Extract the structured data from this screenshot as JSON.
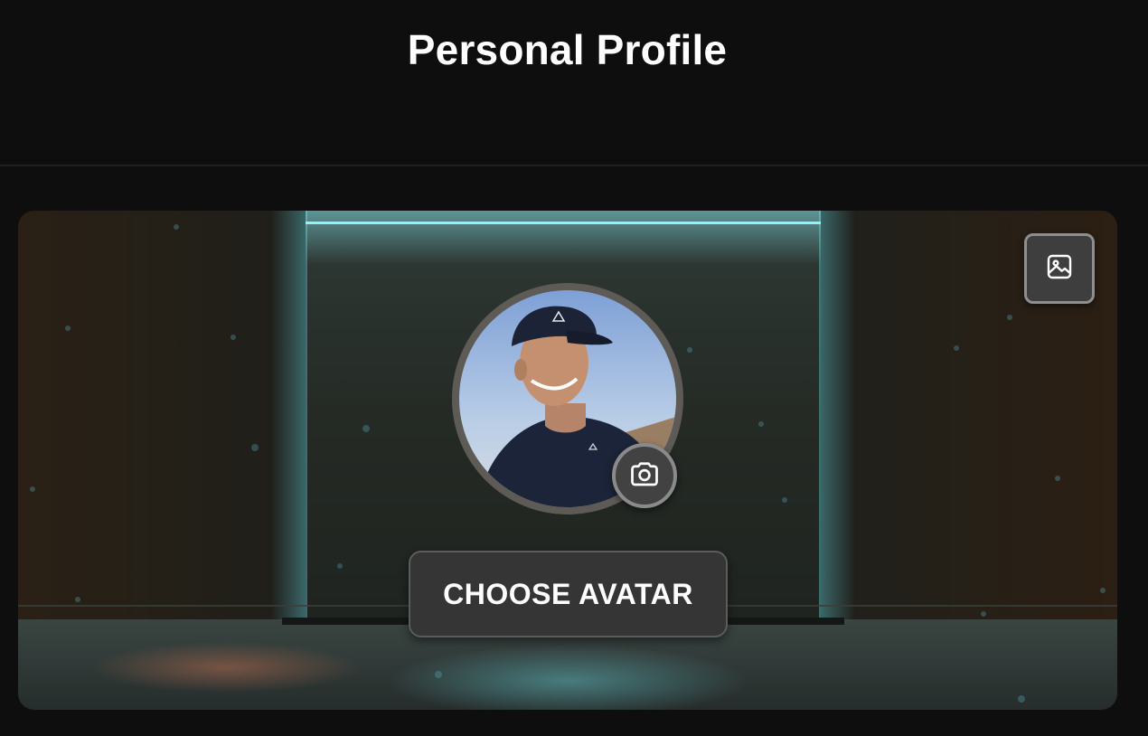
{
  "header": {
    "title": "Personal Profile"
  },
  "banner": {
    "change_background_icon": "image-icon"
  },
  "avatar": {
    "change_photo_icon": "camera-icon",
    "choose_label": "CHOOSE AVATAR"
  },
  "colors": {
    "page_background": "#0e0e0e",
    "neon_accent": "#7fe6ee",
    "button_background": "#353535"
  }
}
